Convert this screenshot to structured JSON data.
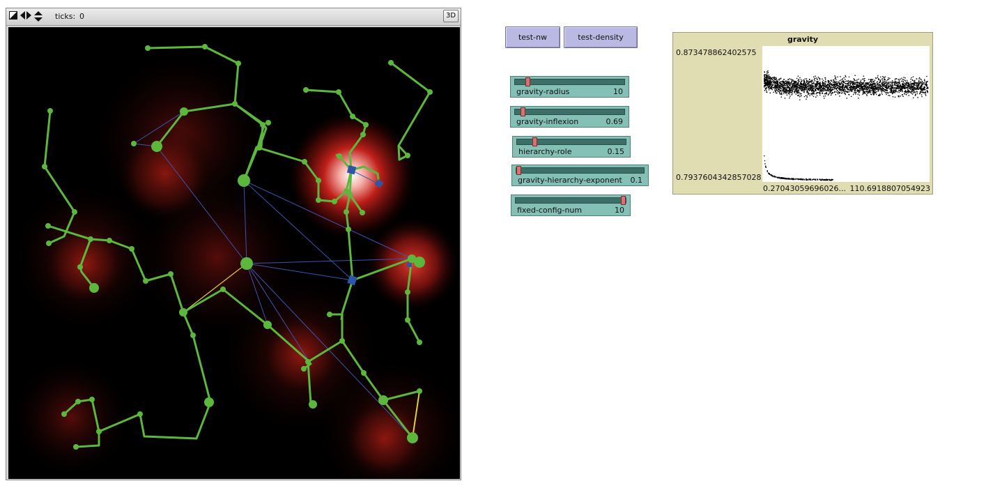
{
  "view": {
    "ticks_label": "ticks:",
    "ticks_value": "0",
    "three_d_label": "3D",
    "icons": [
      "edit-toggle-icon",
      "resize-horizontal-icon",
      "resize-vertical-icon"
    ]
  },
  "buttons": {
    "test_nw": "test-nw",
    "test_density": "test-density"
  },
  "sliders": [
    {
      "name": "gravity-radius",
      "value": "10",
      "fraction": 0.1
    },
    {
      "name": "gravity-inflexion",
      "value": "0.69",
      "fraction": 0.05
    },
    {
      "name": "hierarchy-role",
      "value": "0.15",
      "fraction": 0.15
    },
    {
      "name": "gravity-hierarchy-exponent",
      "value": "0.1",
      "fraction": 0.0
    },
    {
      "name": "fixed-config-num",
      "value": "10",
      "fraction": 1.0
    }
  ],
  "plot": {
    "title": "gravity",
    "y_max": "0.873478862402575",
    "y_min": "0.7937604342857028",
    "x_min": "0.27043059696026...",
    "x_max": "110.6918807054923"
  },
  "colors": {
    "link_green": "#5cb83c",
    "link_blue": "#3b55b0",
    "link_yellow": "#e3d230",
    "node_green": "#5cb83c",
    "node_blue": "#2e55a8",
    "background": "#000000",
    "hotspot": "#c0201a"
  }
}
